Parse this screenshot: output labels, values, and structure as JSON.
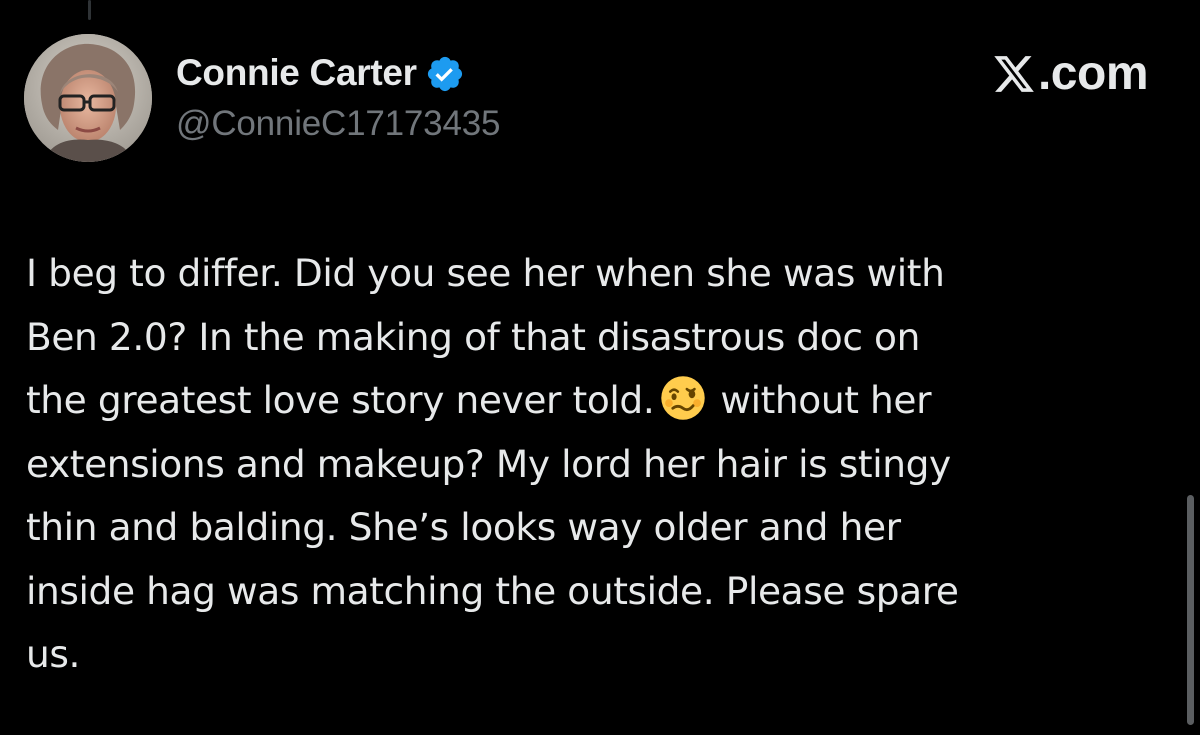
{
  "author": {
    "display_name": "Connie Carter",
    "handle": "@ConnieC17173435",
    "verified_icon": "verified-badge-icon",
    "avatar_icon": "profile-photo"
  },
  "brand": {
    "label": ".com",
    "logo_icon": "x-logo-icon"
  },
  "tweet": {
    "lines": [
      "I beg to differ. Did you see her when she was with",
      "Ben 2.0? In the making of that disastrous doc on",
      "the greatest love story never told.",
      "without her",
      "extensions and makeup? My lord her hair is stingy",
      "thin and balding. She’s looks way older and her",
      "inside hag was matching the outside. Please spare",
      "us."
    ],
    "emoji_icon": "woozy-face-emoji"
  },
  "colors": {
    "background": "#000000",
    "text": "#e7e9ea",
    "secondary_text": "#71767b",
    "verified_blue": "#1d9bf0"
  }
}
